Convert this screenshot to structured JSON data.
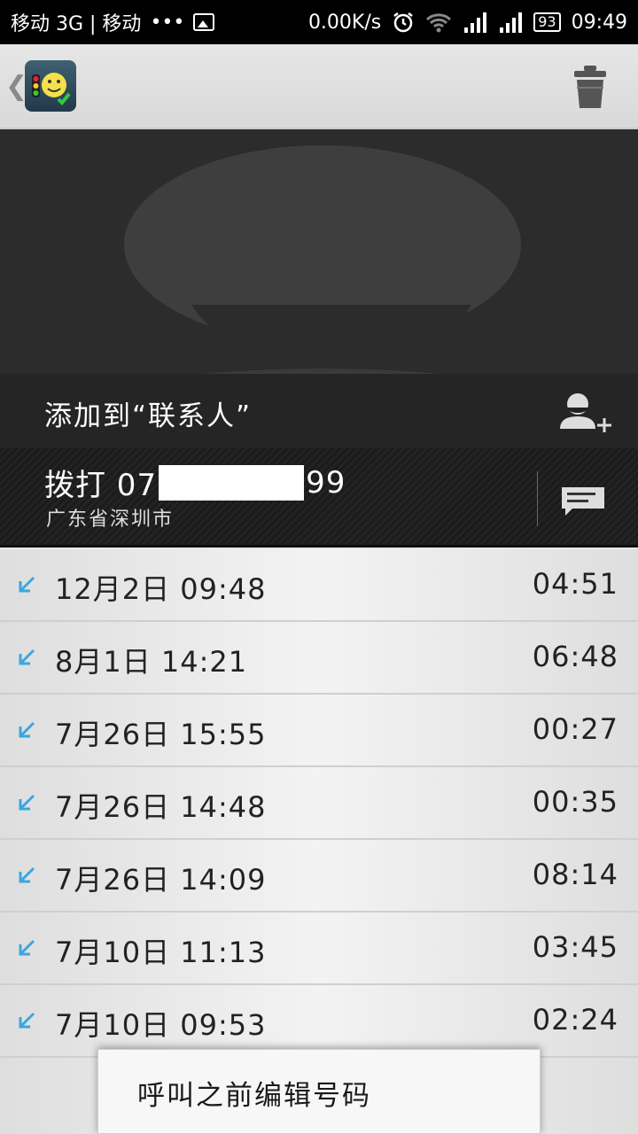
{
  "status_bar": {
    "carriers": "移动 3G | 移动",
    "dots": "•••",
    "speed": "0.00K/s",
    "battery": "93",
    "time": "09:49"
  },
  "action_bar": {
    "back_glyph": "❮",
    "app_icon": "traffic-light-smiley-icon",
    "delete_icon": "trash-icon"
  },
  "contact": {
    "add_label": "添加到“联系人”",
    "dial_prefix": "拨打 07",
    "dial_suffix": "99",
    "location": "广东省深圳市"
  },
  "calls": [
    {
      "datetime": "12月2日 09:48",
      "duration": "04:51"
    },
    {
      "datetime": "8月1日 14:21",
      "duration": "06:48"
    },
    {
      "datetime": "7月26日 15:55",
      "duration": "00:27"
    },
    {
      "datetime": "7月26日 14:48",
      "duration": "00:35"
    },
    {
      "datetime": "7月26日 14:09",
      "duration": "08:14"
    },
    {
      "datetime": "7月10日 11:13",
      "duration": "03:45"
    },
    {
      "datetime": "7月10日 09:53",
      "duration": "02:24"
    }
  ],
  "popup": {
    "item": "呼叫之前编辑号码"
  },
  "colors": {
    "incoming_arrow": "#3aa6e0"
  }
}
